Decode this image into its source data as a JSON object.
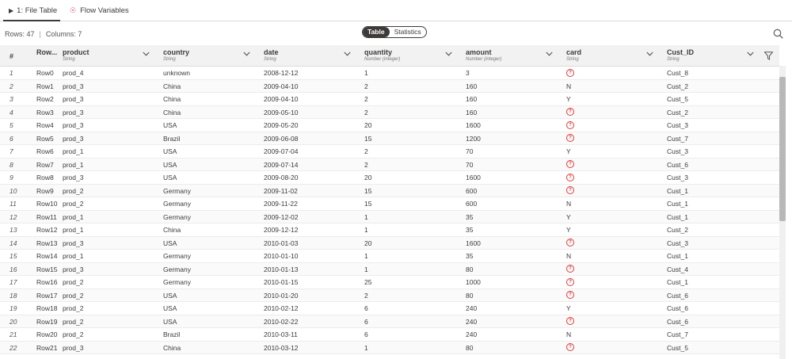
{
  "tabs": [
    {
      "label": "1: File Table",
      "icon": "play-icon"
    },
    {
      "label": "Flow Variables",
      "icon": "flow-variable-icon"
    }
  ],
  "info": {
    "rows": "Rows: 47",
    "sep": "|",
    "columns": "Columns: 7"
  },
  "view_toggle": {
    "options": [
      "Table",
      "Statistics"
    ],
    "selected": "Table"
  },
  "table": {
    "index_header": "#",
    "columns": [
      {
        "title": "Row...",
        "type": ""
      },
      {
        "title": "product",
        "type": "String"
      },
      {
        "title": "country",
        "type": "String"
      },
      {
        "title": "date",
        "type": "String"
      },
      {
        "title": "quantity",
        "type": "Number (integer)"
      },
      {
        "title": "amount",
        "type": "Number (integer)"
      },
      {
        "title": "card",
        "type": "String"
      },
      {
        "title": "Cust_ID",
        "type": "String"
      }
    ],
    "rows": [
      [
        "1",
        "Row0",
        "prod_4",
        "unknown",
        "2008-12-12",
        "1",
        "3",
        "?",
        "Cust_8"
      ],
      [
        "2",
        "Row1",
        "prod_3",
        "China",
        "2009-04-10",
        "2",
        "160",
        "N",
        "Cust_2"
      ],
      [
        "3",
        "Row2",
        "prod_3",
        "China",
        "2009-04-10",
        "2",
        "160",
        "Y",
        "Cust_5"
      ],
      [
        "4",
        "Row3",
        "prod_3",
        "China",
        "2009-05-10",
        "2",
        "160",
        "?",
        "Cust_2"
      ],
      [
        "5",
        "Row4",
        "prod_3",
        "USA",
        "2009-05-20",
        "20",
        "1600",
        "?",
        "Cust_3"
      ],
      [
        "6",
        "Row5",
        "prod_3",
        "Brazil",
        "2009-06-08",
        "15",
        "1200",
        "?",
        "Cust_7"
      ],
      [
        "7",
        "Row6",
        "prod_1",
        "USA",
        "2009-07-04",
        "2",
        "70",
        "Y",
        "Cust_3"
      ],
      [
        "8",
        "Row7",
        "prod_1",
        "USA",
        "2009-07-14",
        "2",
        "70",
        "?",
        "Cust_6"
      ],
      [
        "9",
        "Row8",
        "prod_3",
        "USA",
        "2009-08-20",
        "20",
        "1600",
        "?",
        "Cust_3"
      ],
      [
        "10",
        "Row9",
        "prod_2",
        "Germany",
        "2009-11-02",
        "15",
        "600",
        "?",
        "Cust_1"
      ],
      [
        "11",
        "Row10",
        "prod_2",
        "Germany",
        "2009-11-22",
        "15",
        "600",
        "N",
        "Cust_1"
      ],
      [
        "12",
        "Row11",
        "prod_1",
        "Germany",
        "2009-12-02",
        "1",
        "35",
        "Y",
        "Cust_1"
      ],
      [
        "13",
        "Row12",
        "prod_1",
        "China",
        "2009-12-12",
        "1",
        "35",
        "Y",
        "Cust_2"
      ],
      [
        "14",
        "Row13",
        "prod_3",
        "USA",
        "2010-01-03",
        "20",
        "1600",
        "?",
        "Cust_3"
      ],
      [
        "15",
        "Row14",
        "prod_1",
        "Germany",
        "2010-01-10",
        "1",
        "35",
        "N",
        "Cust_1"
      ],
      [
        "16",
        "Row15",
        "prod_3",
        "Germany",
        "2010-01-13",
        "1",
        "80",
        "?",
        "Cust_4"
      ],
      [
        "17",
        "Row16",
        "prod_2",
        "Germany",
        "2010-01-15",
        "25",
        "1000",
        "?",
        "Cust_1"
      ],
      [
        "18",
        "Row17",
        "prod_2",
        "USA",
        "2010-01-20",
        "2",
        "80",
        "?",
        "Cust_6"
      ],
      [
        "19",
        "Row18",
        "prod_2",
        "USA",
        "2010-02-12",
        "6",
        "240",
        "Y",
        "Cust_6"
      ],
      [
        "20",
        "Row19",
        "prod_2",
        "USA",
        "2010-02-22",
        "6",
        "240",
        "?",
        "Cust_6"
      ],
      [
        "21",
        "Row20",
        "prod_2",
        "Brazil",
        "2010-03-11",
        "6",
        "240",
        "N",
        "Cust_7"
      ],
      [
        "22",
        "Row21",
        "prod_3",
        "China",
        "2010-03-12",
        "1",
        "80",
        "?",
        "Cust_5"
      ]
    ]
  },
  "colors": {
    "missing": "#e03c3c",
    "header_bg": "#f2f2f2",
    "text": "#3e3a39"
  }
}
